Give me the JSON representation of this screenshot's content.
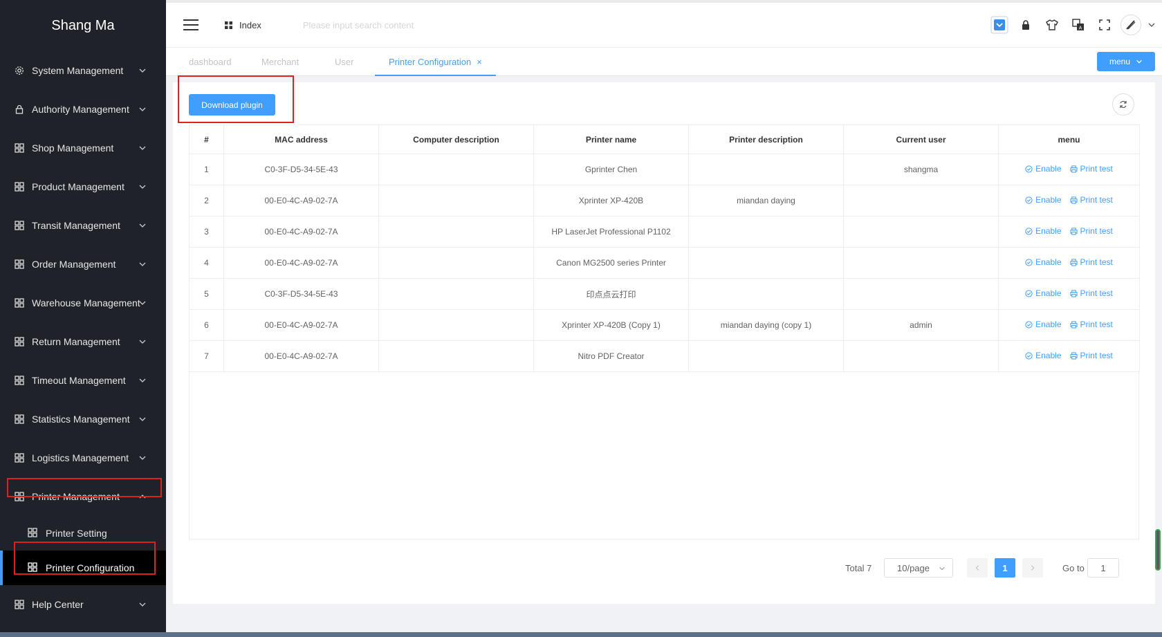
{
  "brand": "Shang Ma",
  "sidebar": {
    "items": [
      {
        "label": "System Management",
        "icon": "gear-icon"
      },
      {
        "label": "Authority Management",
        "icon": "lock-icon"
      },
      {
        "label": "Shop Management",
        "icon": "grid-icon"
      },
      {
        "label": "Product Management",
        "icon": "grid-icon"
      },
      {
        "label": "Transit Management",
        "icon": "grid-icon"
      },
      {
        "label": "Order Management",
        "icon": "grid-icon"
      },
      {
        "label": "Warehouse Management",
        "icon": "grid-icon"
      },
      {
        "label": "Return Management",
        "icon": "grid-icon"
      },
      {
        "label": "Timeout Management",
        "icon": "grid-icon"
      },
      {
        "label": "Statistics Management",
        "icon": "grid-icon"
      },
      {
        "label": "Logistics Management",
        "icon": "grid-icon"
      },
      {
        "label": "Printer Management",
        "icon": "grid-icon",
        "expanded": true
      },
      {
        "label": "Help Center",
        "icon": "grid-icon"
      }
    ],
    "subitems": [
      {
        "label": "Printer Setting"
      },
      {
        "label": "Printer Configuration",
        "active": true
      }
    ]
  },
  "header": {
    "breadcrumb": "Index",
    "search_placeholder": "Please input search content"
  },
  "tabs": [
    {
      "label": "dashboard"
    },
    {
      "label": "Merchant"
    },
    {
      "label": "User"
    },
    {
      "label": "Printer Configuration",
      "active": true,
      "close": "×"
    }
  ],
  "menu_button": "menu",
  "toolbar": {
    "download_label": "Download plugin"
  },
  "table": {
    "columns": [
      "#",
      "MAC address",
      "Computer description",
      "Printer name",
      "Printer description",
      "Current user",
      "menu"
    ],
    "enable_label": "Enable",
    "print_label": "Print test",
    "rows": [
      {
        "no": "1",
        "mac": "C0-3F-D5-34-5E-43",
        "computer": "",
        "printer": "Gprinter Chen",
        "desc": "",
        "user": "shangma"
      },
      {
        "no": "2",
        "mac": "00-E0-4C-A9-02-7A",
        "computer": "",
        "printer": "Xprinter XP-420B",
        "desc": "miandan daying",
        "user": ""
      },
      {
        "no": "3",
        "mac": "00-E0-4C-A9-02-7A",
        "computer": "",
        "printer": "HP LaserJet Professional P1102",
        "desc": "",
        "user": ""
      },
      {
        "no": "4",
        "mac": "00-E0-4C-A9-02-7A",
        "computer": "",
        "printer": "Canon MG2500 series Printer",
        "desc": "",
        "user": ""
      },
      {
        "no": "5",
        "mac": "C0-3F-D5-34-5E-43",
        "computer": "",
        "printer": "印点点云打印",
        "desc": "",
        "user": ""
      },
      {
        "no": "6",
        "mac": "00-E0-4C-A9-02-7A",
        "computer": "",
        "printer": "Xprinter XP-420B (Copy 1)",
        "desc": "miandan daying (copy 1)",
        "user": "admin"
      },
      {
        "no": "7",
        "mac": "00-E0-4C-A9-02-7A",
        "computer": "",
        "printer": "Nitro PDF Creator",
        "desc": "",
        "user": ""
      }
    ]
  },
  "pagination": {
    "total": "Total 7",
    "page_size": "10/page",
    "current": "1",
    "goto_label": "Go to",
    "goto_value": "1"
  },
  "colors": {
    "accent": "#409eff",
    "sidebar_bg": "#1f2329",
    "highlight_box": "#e02020"
  }
}
